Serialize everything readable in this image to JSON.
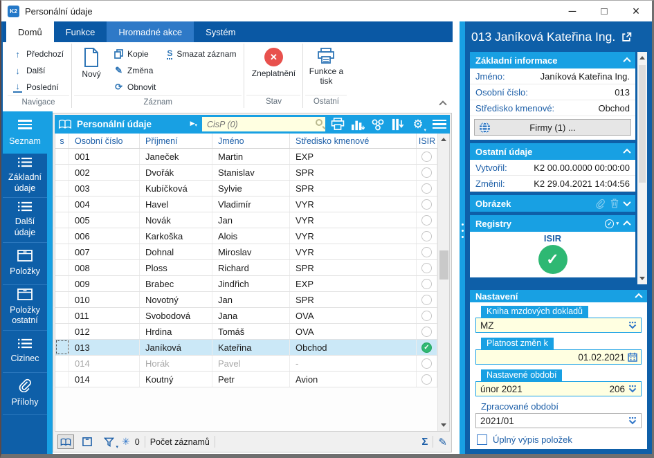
{
  "window": {
    "title": "Personální údaje"
  },
  "icons": {
    "minimize": "─",
    "maximize": "□",
    "close": "×",
    "up_arrow": "↑",
    "down_arrow": "↓",
    "letter_s": "S",
    "pencil": "✎",
    "refresh": "⟳",
    "close_x": "✕",
    "gear": "⚙",
    "sigma": "Σ",
    "asterisk": "✳",
    "check": "✓",
    "play": "▶",
    "caret_down": "▾",
    "k2": "K2"
  },
  "ribbon": {
    "tabs": [
      {
        "label": "Domů"
      },
      {
        "label": "Funkce"
      },
      {
        "label": "Hromadné akce"
      },
      {
        "label": "Systém"
      }
    ],
    "nav": {
      "prev": "Předchozí",
      "next": "Další",
      "last": "Poslední",
      "group": "Navigace"
    },
    "record": {
      "new": "Nový",
      "copy": "Kopie",
      "change": "Změna",
      "refresh": "Obnovit",
      "delete": "Smazat záznam",
      "group": "Záznam"
    },
    "state": {
      "invalidate": "Zneplatnění",
      "group": "Stav"
    },
    "other": {
      "print": "Funkce a tisk",
      "group": "Ostatní"
    }
  },
  "sidebar": {
    "items": [
      {
        "label": "Seznam"
      },
      {
        "label": "Základní údaje"
      },
      {
        "label": "Další údaje"
      },
      {
        "label": "Položky"
      },
      {
        "label": "Položky ostatní"
      },
      {
        "label": "Cizinec"
      },
      {
        "label": "Přílohy"
      }
    ]
  },
  "grid": {
    "title": "Personální údaje",
    "search_placeholder": "CisP (0)",
    "columns": {
      "s": "s",
      "num": "Osobní číslo",
      "surname": "Příjmení",
      "name": "Jméno",
      "dept": "Středisko kmenové",
      "isir": "ISIR"
    },
    "rows": [
      {
        "num": "001",
        "surname": "Janeček",
        "name": "Martin",
        "dept": "EXP"
      },
      {
        "num": "002",
        "surname": "Dvořák",
        "name": "Stanislav",
        "dept": "SPR"
      },
      {
        "num": "003",
        "surname": "Kubíčková",
        "name": "Sylvie",
        "dept": "SPR"
      },
      {
        "num": "004",
        "surname": "Havel",
        "name": "Vladimír",
        "dept": "VYR"
      },
      {
        "num": "005",
        "surname": "Novák",
        "name": "Jan",
        "dept": "VYR"
      },
      {
        "num": "006",
        "surname": "Karkoška",
        "name": "Alois",
        "dept": "VYR"
      },
      {
        "num": "007",
        "surname": "Dohnal",
        "name": "Miroslav",
        "dept": "VYR"
      },
      {
        "num": "008",
        "surname": "Ploss",
        "name": "Richard",
        "dept": "SPR"
      },
      {
        "num": "009",
        "surname": "Brabec",
        "name": "Jindřich",
        "dept": "EXP"
      },
      {
        "num": "010",
        "surname": "Novotný",
        "name": "Jan",
        "dept": "SPR"
      },
      {
        "num": "011",
        "surname": "Svobodová",
        "name": "Jana",
        "dept": "OVA"
      },
      {
        "num": "012",
        "surname": "Hrdina",
        "name": "Tomáš",
        "dept": "OVA"
      },
      {
        "num": "013",
        "surname": "Janíková",
        "name": "Kateřina",
        "dept": "Obchod",
        "selected": true,
        "isir": "ok"
      },
      {
        "num": "014",
        "surname": "Horák",
        "name": "Pavel",
        "dept": "-",
        "disabled": true
      },
      {
        "num": "014",
        "surname": "Koutný",
        "name": "Petr",
        "dept": "Avion"
      }
    ],
    "status": {
      "filter_count": "0",
      "count_label": "Počet záznamů"
    }
  },
  "panel": {
    "title": "013 Janíková Kateřina Ing.",
    "basic": {
      "title": "Základní informace",
      "name_label": "Jméno:",
      "name_value": "Janíková Kateřina Ing.",
      "num_label": "Osobní číslo:",
      "num_value": "013",
      "dept_label": "Středisko kmenové:",
      "dept_value": "Obchod",
      "firms_button": "Firmy (1) ..."
    },
    "other": {
      "title": "Ostatní údaje",
      "created_label": "Vytvořil:",
      "created_value": "K2 00.00.0000 00:00:00",
      "changed_label": "Změnil:",
      "changed_value": "K2 29.04.2021 14:04:56"
    },
    "picture": {
      "title": "Obrázek"
    },
    "registry": {
      "title": "Registry",
      "badge": "ISIR"
    },
    "settings": {
      "title": "Nastavení",
      "book_label": "Kniha mzdových dokladů",
      "book_value": "MZ",
      "validity_label": "Platnost změn k",
      "validity_value": "01.02.2021",
      "period_label": "Nastavené období",
      "period_value": "únor 2021",
      "period_code": "206",
      "processed_label": "Zpracované období",
      "processed_value": "2021/01",
      "checkbox_label": "Úplný výpis položek"
    }
  },
  "colors": {
    "dark_blue": "#0e5fa8",
    "cyan": "#18a0e3",
    "tab_highlight": "#2e79c7",
    "input_yellow": "#ffffe1",
    "row_selected": "#cbe8f7",
    "green": "#2eb873",
    "red": "#e8514d"
  }
}
